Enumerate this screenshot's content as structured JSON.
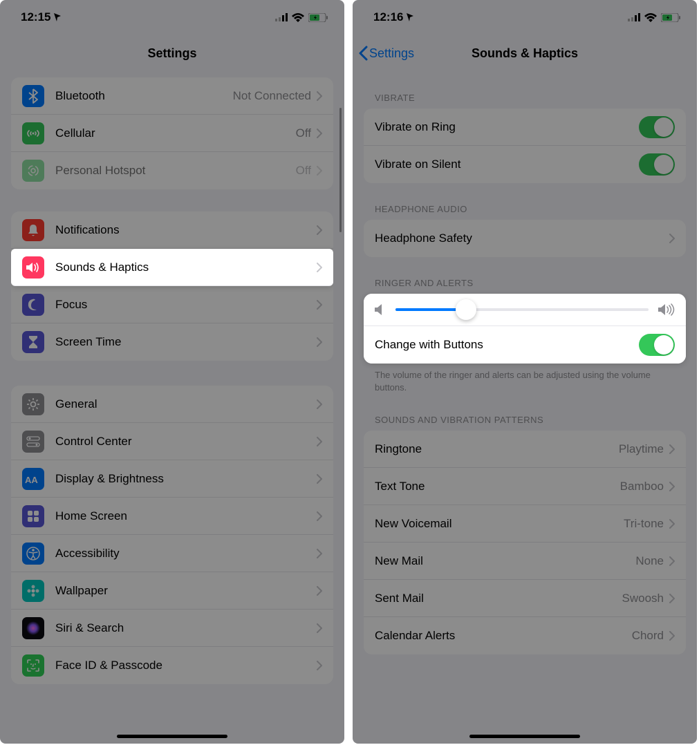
{
  "left": {
    "status": {
      "time": "12:15"
    },
    "nav": {
      "title": "Settings"
    },
    "group1": [
      {
        "icon": "bluetooth",
        "color": "#007aff",
        "label": "Bluetooth",
        "value": "Not Connected"
      },
      {
        "icon": "cellular",
        "color": "#34c759",
        "label": "Cellular",
        "value": "Off"
      },
      {
        "icon": "hotspot",
        "color": "#34c759",
        "label": "Personal Hotspot",
        "value": "Off",
        "dim": true
      }
    ],
    "group2": [
      {
        "icon": "bell",
        "color": "#ff3b30",
        "label": "Notifications"
      },
      {
        "icon": "speaker",
        "color": "#ff375f",
        "label": "Sounds & Haptics",
        "highlight": true
      },
      {
        "icon": "moon",
        "color": "#5856d6",
        "label": "Focus"
      },
      {
        "icon": "hourglass",
        "color": "#5856d6",
        "label": "Screen Time"
      }
    ],
    "group3": [
      {
        "icon": "gear",
        "color": "#8e8e93",
        "label": "General"
      },
      {
        "icon": "switches",
        "color": "#8e8e93",
        "label": "Control Center"
      },
      {
        "icon": "aa",
        "color": "#007aff",
        "label": "Display & Brightness"
      },
      {
        "icon": "grid",
        "color": "#5856d6",
        "label": "Home Screen"
      },
      {
        "icon": "accessibility",
        "color": "#007aff",
        "label": "Accessibility"
      },
      {
        "icon": "flower",
        "color": "#00c7be",
        "label": "Wallpaper"
      },
      {
        "icon": "siri",
        "color": "#1c1c1e",
        "label": "Siri & Search"
      },
      {
        "icon": "faceid",
        "color": "#30d158",
        "label": "Face ID & Passcode"
      }
    ]
  },
  "right": {
    "status": {
      "time": "12:16"
    },
    "nav": {
      "back": "Settings",
      "title": "Sounds & Haptics"
    },
    "sections": {
      "vibrate": {
        "header": "VIBRATE",
        "rows": [
          {
            "label": "Vibrate on Ring",
            "toggle": true
          },
          {
            "label": "Vibrate on Silent",
            "toggle": true
          }
        ]
      },
      "headphone": {
        "header": "HEADPHONE AUDIO",
        "rows": [
          {
            "label": "Headphone Safety",
            "chevron": true
          }
        ]
      },
      "ringer": {
        "header": "RINGER AND ALERTS",
        "slider_value": 28,
        "change_label": "Change with Buttons",
        "change_toggle": true,
        "footer": "The volume of the ringer and alerts can be adjusted using the volume buttons."
      },
      "sounds": {
        "header": "SOUNDS AND VIBRATION PATTERNS",
        "rows": [
          {
            "label": "Ringtone",
            "value": "Playtime"
          },
          {
            "label": "Text Tone",
            "value": "Bamboo"
          },
          {
            "label": "New Voicemail",
            "value": "Tri-tone"
          },
          {
            "label": "New Mail",
            "value": "None"
          },
          {
            "label": "Sent Mail",
            "value": "Swoosh"
          },
          {
            "label": "Calendar Alerts",
            "value": "Chord"
          }
        ]
      }
    }
  }
}
